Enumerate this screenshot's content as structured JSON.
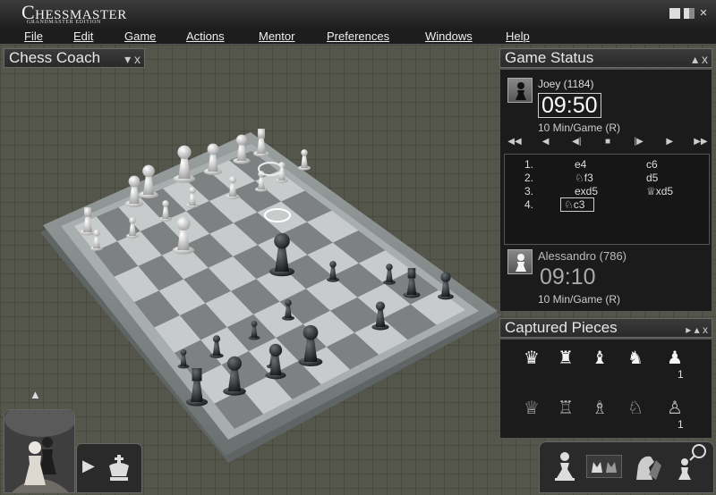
{
  "window": {
    "logo": "Chessmaster",
    "logo_sub": "GRANDMASTER EDITION",
    "minimize_icon": "minimize-icon",
    "restore_icon": "restore-icon",
    "close_icon": "close-icon"
  },
  "menu": {
    "items": [
      "File",
      "Edit",
      "Game",
      "Actions",
      "Mentor",
      "Preferences",
      "Windows",
      "Help"
    ]
  },
  "chess_coach": {
    "title": "Chess Coach",
    "collapse_glyph": "▾",
    "close_glyph": "x"
  },
  "game_status": {
    "title": "Game Status",
    "collapse_glyph": "▴",
    "close_glyph": "x",
    "top_player": {
      "name": "Joey (1184)",
      "clock": "09:50",
      "time_control": "10 Min/Game (R)",
      "piece": "black-pawn"
    },
    "bottom_player": {
      "name": "Alessandro (786)",
      "clock": "09:10",
      "time_control": "10 Min/Game (R)",
      "piece": "white-pawn"
    },
    "nav_glyphs": [
      "◀◀",
      "◀",
      "◀|",
      "■",
      "|▶",
      "▶",
      "▶▶"
    ],
    "moves": [
      {
        "num": "1.",
        "white": "e4",
        "black": "c6"
      },
      {
        "num": "2.",
        "white": "♘f3",
        "black": "d5"
      },
      {
        "num": "3.",
        "white": "exd5",
        "black": "♕xd5"
      },
      {
        "num": "4.",
        "white": "♘c3",
        "black": ""
      }
    ]
  },
  "captured_pieces": {
    "title": "Captured Pieces",
    "controls_glyph": "▸ ▴",
    "close_glyph": "x",
    "white_row": [
      "queen",
      "rook",
      "bishop",
      "knight",
      "pawn"
    ],
    "black_row": [
      "queen",
      "rook",
      "bishop",
      "knight",
      "pawn"
    ],
    "white_pawn_count": "1",
    "black_pawn_count": "1"
  },
  "bottom_left": {
    "up_arrow": "▲",
    "play_arrow": "▶"
  },
  "colors": {
    "background": "#54564b",
    "panel": "#1b1b1b",
    "board_light": "#c7cbcb",
    "board_dark": "#7d8181"
  }
}
